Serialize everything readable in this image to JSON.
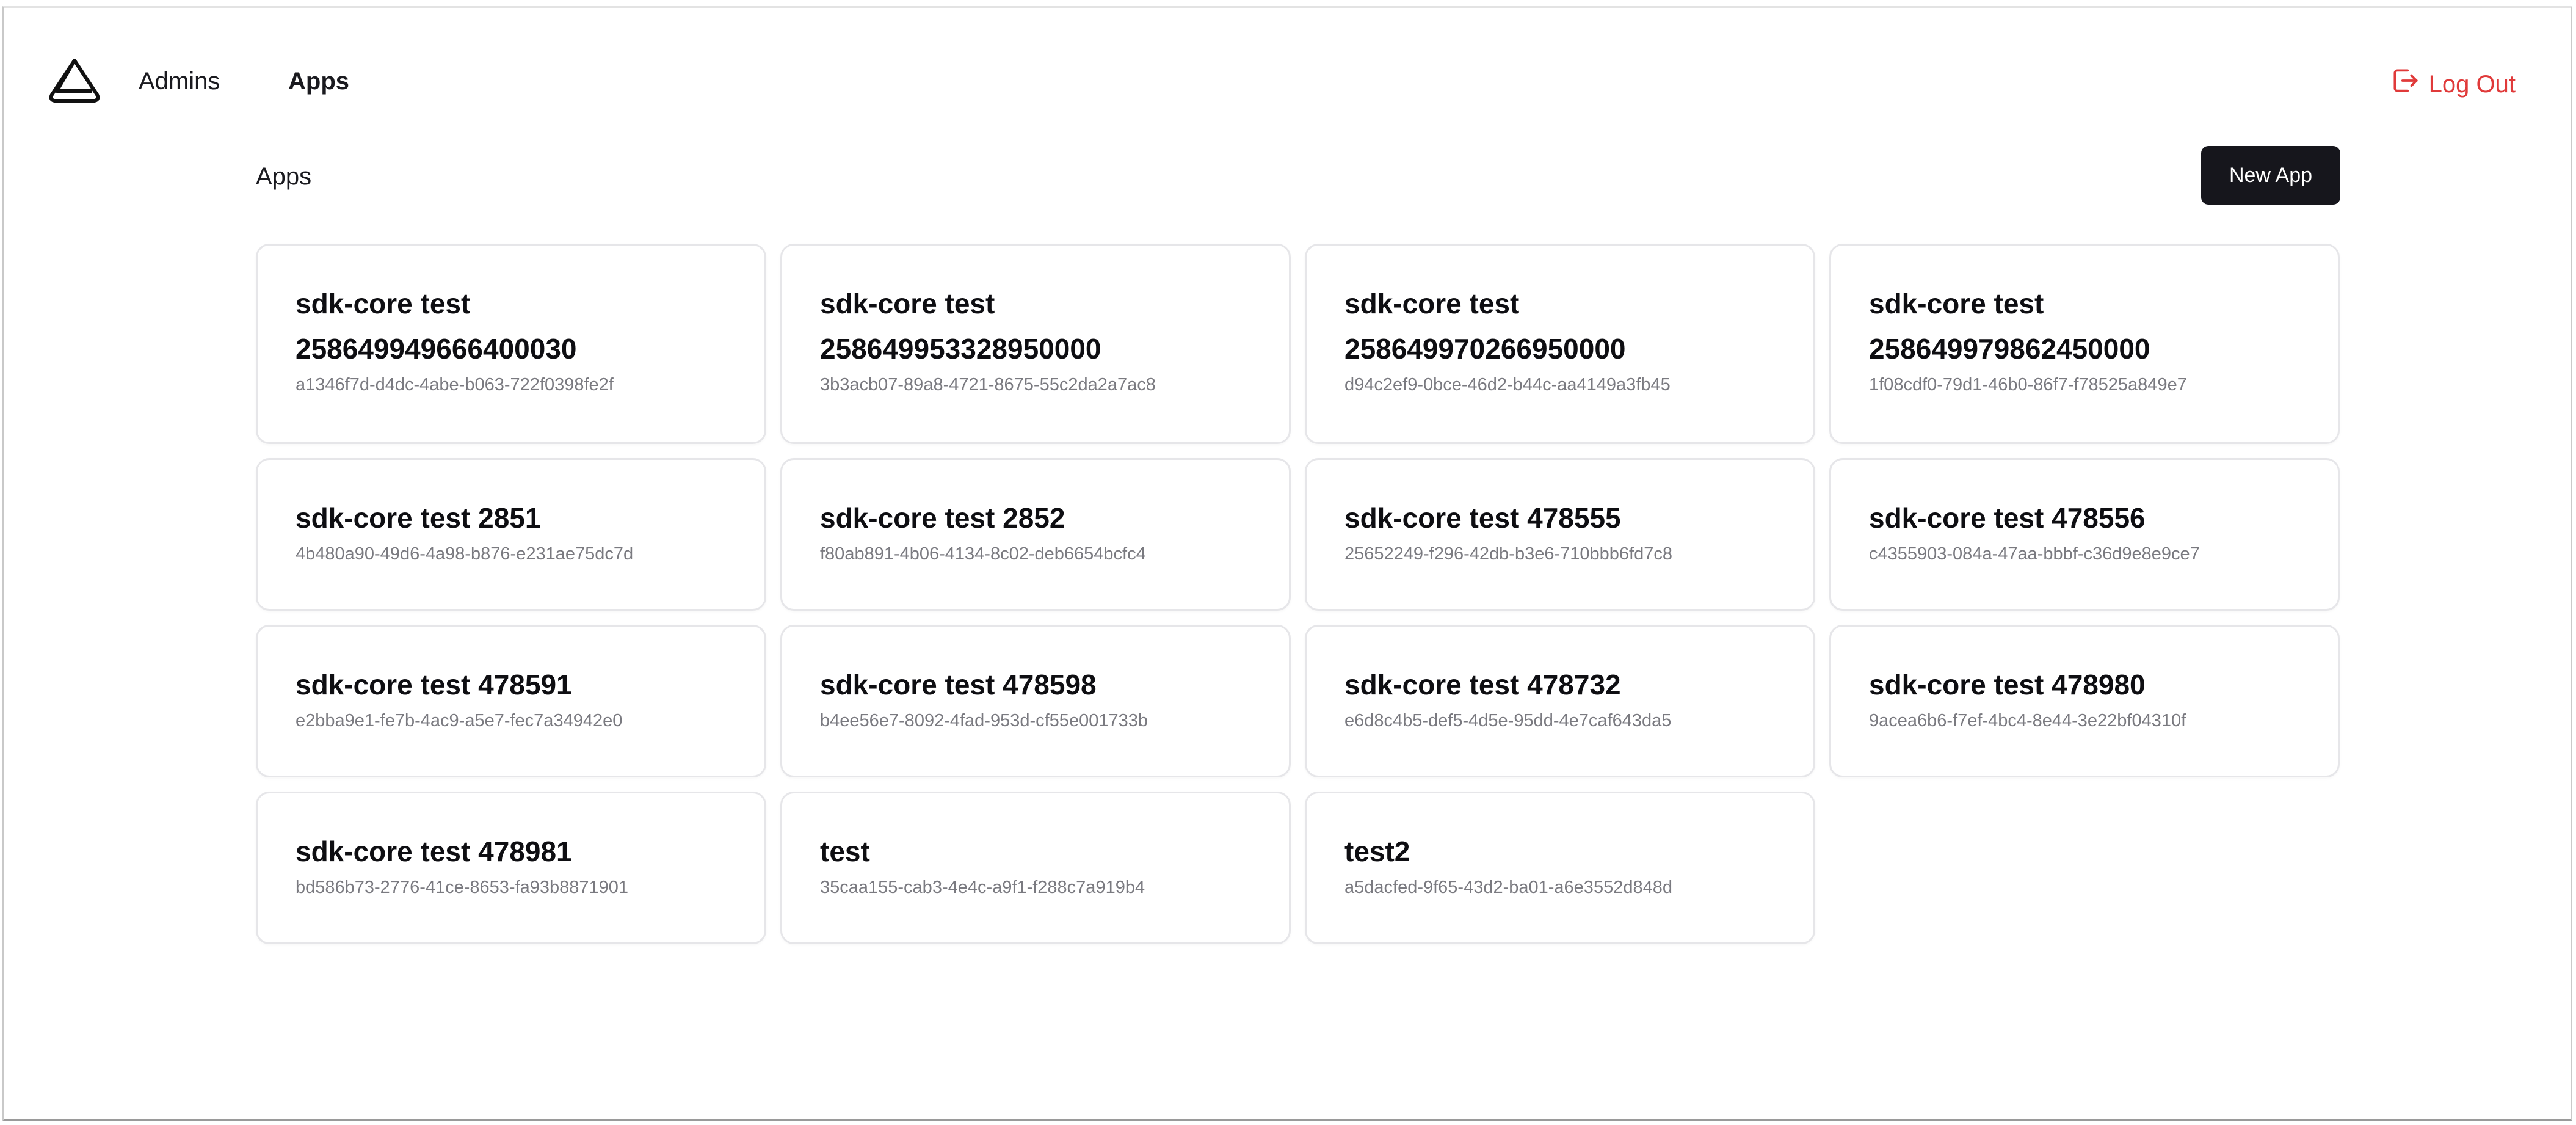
{
  "header": {
    "nav": [
      {
        "label": "Admins"
      },
      {
        "label": "Apps"
      }
    ],
    "logout_label": "Log Out",
    "accent_logout": "#e03a3a"
  },
  "page": {
    "title": "Apps",
    "new_app_label": "New App"
  },
  "apps": [
    {
      "name": "sdk-core test 258649949666400030",
      "id": "a1346f7d-d4dc-4abe-b063-722f0398fe2f"
    },
    {
      "name": "sdk-core test 258649953328950000",
      "id": "3b3acb07-89a8-4721-8675-55c2da2a7ac8"
    },
    {
      "name": "sdk-core test 258649970266950000",
      "id": "d94c2ef9-0bce-46d2-b44c-aa4149a3fb45"
    },
    {
      "name": "sdk-core test 258649979862450000",
      "id": "1f08cdf0-79d1-46b0-86f7-f78525a849e7"
    },
    {
      "name": "sdk-core test 2851",
      "id": "4b480a90-49d6-4a98-b876-e231ae75dc7d"
    },
    {
      "name": "sdk-core test 2852",
      "id": "f80ab891-4b06-4134-8c02-deb6654bcfc4"
    },
    {
      "name": "sdk-core test 478555",
      "id": "25652249-f296-42db-b3e6-710bbb6fd7c8"
    },
    {
      "name": "sdk-core test 478556",
      "id": "c4355903-084a-47aa-bbbf-c36d9e8e9ce7"
    },
    {
      "name": "sdk-core test 478591",
      "id": "e2bba9e1-fe7b-4ac9-a5e7-fec7a34942e0"
    },
    {
      "name": "sdk-core test 478598",
      "id": "b4ee56e7-8092-4fad-953d-cf55e001733b"
    },
    {
      "name": "sdk-core test 478732",
      "id": "e6d8c4b5-def5-4d5e-95dd-4e7caf643da5"
    },
    {
      "name": "sdk-core test 478980",
      "id": "9acea6b6-f7ef-4bc4-8e44-3e22bf04310f"
    },
    {
      "name": "sdk-core test 478981",
      "id": "bd586b73-2776-41ce-8653-fa93b8871901"
    },
    {
      "name": "test",
      "id": "35caa155-cab3-4e4c-a9f1-f288c7a919b4"
    },
    {
      "name": "test2",
      "id": "a5dacfed-9f65-43d2-ba01-a6e3552d848d"
    }
  ]
}
